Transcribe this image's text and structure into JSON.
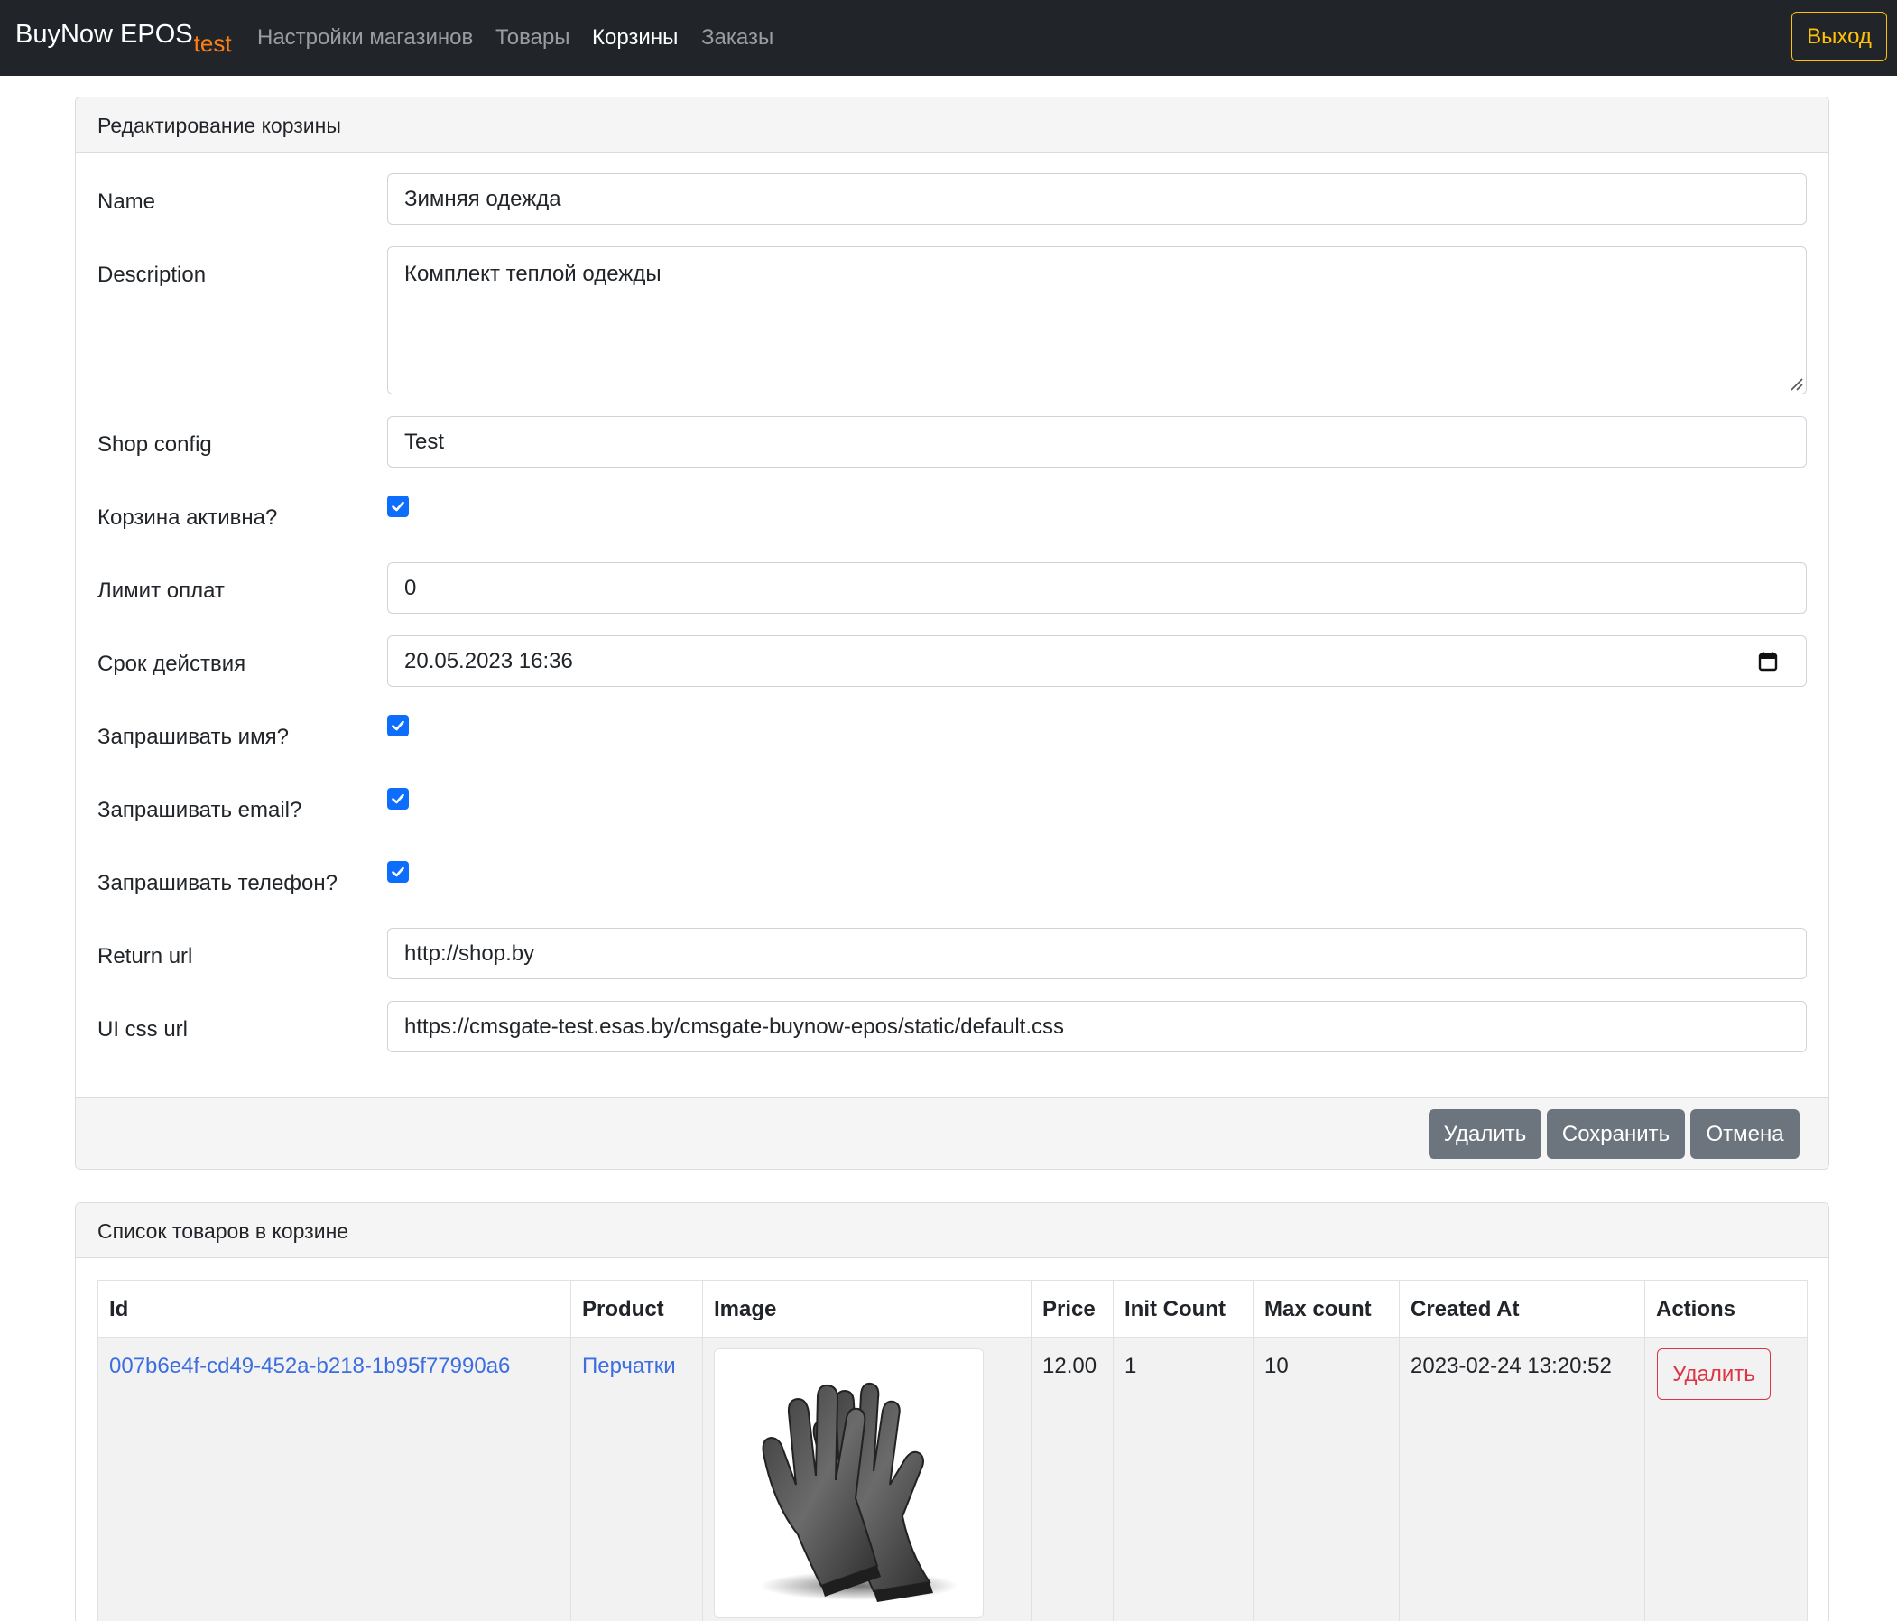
{
  "navbar": {
    "brand": "BuyNow EPOS",
    "brand_sub": "test",
    "links": [
      "Настройки магазинов",
      "Товары",
      "Корзины",
      "Заказы"
    ],
    "active_link": "Корзины",
    "logout_label": "Выход"
  },
  "edit_card": {
    "title": "Редактирование корзины",
    "fields": {
      "name": {
        "label": "Name",
        "value": "Зимняя одежда"
      },
      "description": {
        "label": "Description",
        "value": "Комплект теплой одежды"
      },
      "shop_config": {
        "label": "Shop config",
        "value": "Test"
      },
      "active": {
        "label": "Корзина активна?",
        "checked": true
      },
      "payment_limit": {
        "label": "Лимит оплат",
        "value": "0"
      },
      "expiry": {
        "label": "Срок действия",
        "value": "20.05.2023 16:36"
      },
      "ask_name": {
        "label": "Запрашивать имя?",
        "checked": true
      },
      "ask_email": {
        "label": "Запрашивать email?",
        "checked": true
      },
      "ask_phone": {
        "label": "Запрашивать телефон?",
        "checked": true
      },
      "return_url": {
        "label": "Return url",
        "value": "http://shop.by"
      },
      "ui_css_url": {
        "label": "UI css url",
        "value": "https://cmsgate-test.esas.by/cmsgate-buynow-epos/static/default.css"
      }
    },
    "buttons": {
      "delete": "Удалить",
      "save": "Сохранить",
      "cancel": "Отмена"
    }
  },
  "items_card": {
    "title": "Список товаров в корзине",
    "columns": [
      "Id",
      "Product",
      "Image",
      "Price",
      "Init Count",
      "Max count",
      "Created At",
      "Actions"
    ],
    "rows": [
      {
        "id": "007b6e4f-cd49-452a-b218-1b95f77990a6",
        "product": "Перчатки",
        "image": "gloves-image",
        "price": "12.00",
        "init_count": "1",
        "max_count": "10",
        "created_at": "2023-02-24 13:20:52",
        "action": "Удалить"
      }
    ]
  },
  "colors": {
    "navbar_bg": "#212529",
    "brand_sub": "#fd7e14",
    "logout": "#ffc107",
    "primary": "#0d6efd",
    "secondary": "#6c757d",
    "danger": "#dc3545",
    "link": "#3d6ee0"
  }
}
